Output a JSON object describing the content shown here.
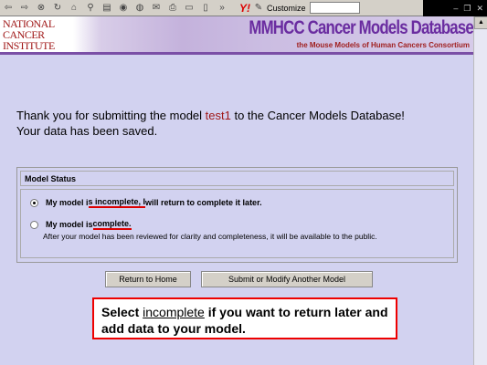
{
  "toolbar": {
    "customize_label": "Customize",
    "yahoo_label": "Y!",
    "overflow": "»"
  },
  "banner": {
    "nci_lines": [
      "NATIONAL",
      "CANCER",
      "INSTITUTE"
    ],
    "title": "MMHCC Cancer Models Database",
    "subtitle": "the Mouse Models of Human Cancers Consortium"
  },
  "message": {
    "prefix": "Thank you for submitting the model ",
    "model": "test1",
    "suffix": " to the Cancer Models Database!",
    "line2": "Your data has been saved."
  },
  "status": {
    "heading": "Model Status",
    "opt1_pre": "My model i",
    "opt1_ul": "s incomplete, I",
    "opt1_post": " will return to complete it later.",
    "opt2_pre": "My model is ",
    "opt2_ul": "complete.",
    "note": "After your model has been reviewed for clarity and completeness, it will be available to the public."
  },
  "buttons": {
    "home": "Return to Home",
    "submit": "Submit or Modify Another Model"
  },
  "callout": {
    "pre": "Select ",
    "kw": "incomplete",
    "post": " if you want to return later and add data to your model."
  }
}
